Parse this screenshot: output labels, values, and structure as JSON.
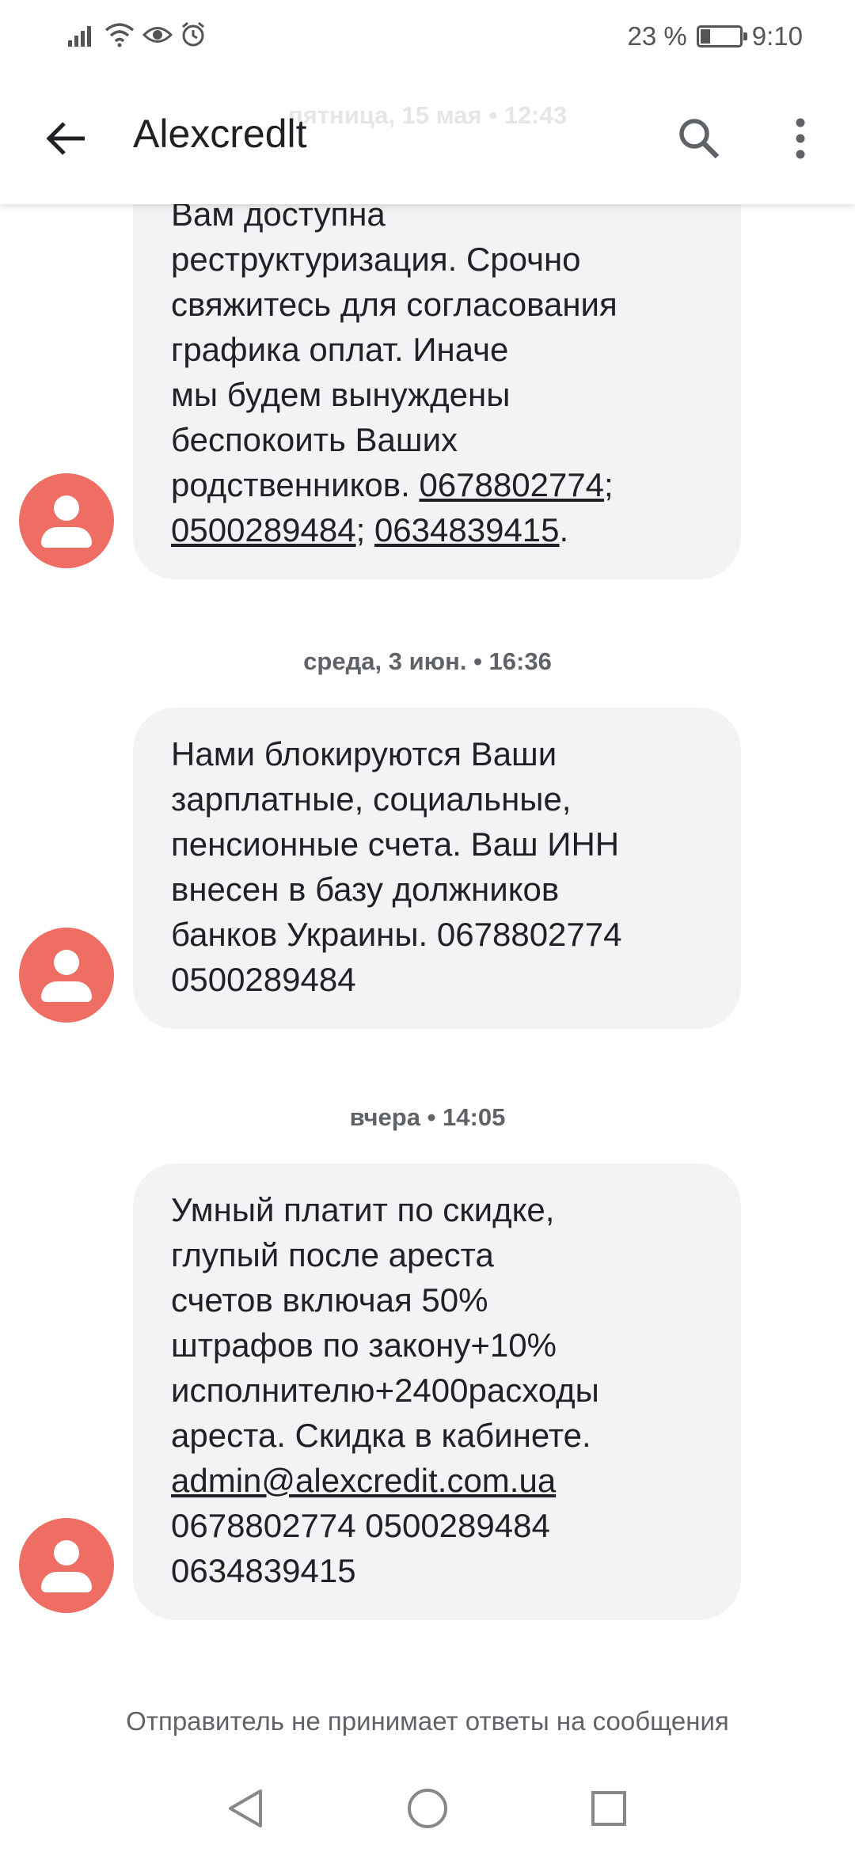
{
  "status_bar": {
    "battery": "23 %",
    "time": "9:10",
    "icons": [
      "signal-icon",
      "wifi-icon",
      "eye-icon",
      "alarm-icon",
      "battery-charging-icon"
    ]
  },
  "app_bar": {
    "title": "Alexcredlt",
    "scrolled_date": "пятница, 15 мая • 12:43",
    "back_icon": "arrow-back-icon",
    "search_icon": "search-icon",
    "more_icon": "more-vert-icon"
  },
  "messages": [
    {
      "parts": [
        {
          "text": "Вам доступна\nреструктуризация. Срочно\nсвяжитесь для согласования\nграфика оплат. Иначе\nмы будем вынуждены\nбеспокоить Ваших\nродственников. "
        },
        {
          "text": "0678802774",
          "link": true
        },
        {
          "text": ";\n"
        },
        {
          "text": "0500289484",
          "link": true
        },
        {
          "text": "; "
        },
        {
          "text": "0634839415",
          "link": true
        },
        {
          "text": "."
        }
      ]
    },
    {
      "date": "среда, 3 июн. • 16:36",
      "parts": [
        {
          "text": "Нами блокируются Ваши\nзарплатные, социальные,\nпенсионные счета. Ваш ИНН\nвнесен в базу должников\nбанков Украины. 0678802774\n0500289484"
        }
      ]
    },
    {
      "date": "вчера • 14:05",
      "parts": [
        {
          "text": "Умный платит по скидке,\nглупый после ареста\nсчетов включая 50%\nштрафов по закону+10%\nисполнителю+2400расходы\nареста. Скидка в кабинете.\n"
        },
        {
          "text": "admin@alexcredit.com.ua",
          "link": true
        },
        {
          "text": "\n0678802774 0500289484\n0634839415"
        }
      ]
    }
  ],
  "footer": {
    "note": "Отправитель не принимает ответы на сообщения"
  },
  "colors": {
    "avatar": "#ee6e63",
    "bubble": "#f1f3f4",
    "text": "#202124",
    "secondary_text": "#5f6368"
  }
}
